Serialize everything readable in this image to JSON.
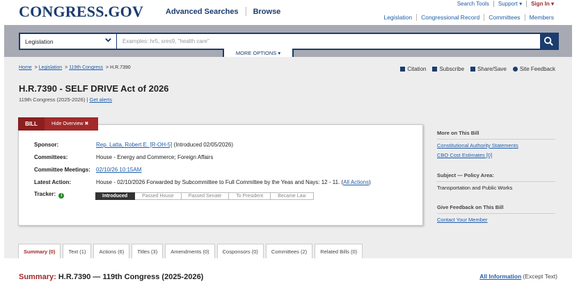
{
  "header": {
    "logo": "CONGRESS.GOV",
    "primary_nav": [
      "Advanced Searches",
      "Browse"
    ],
    "utility": {
      "search_tools": "Search Tools",
      "support": "Support ▾",
      "sign_in": "Sign In ▾"
    },
    "secondary_nav": [
      "Legislation",
      "Congressional Record",
      "Committees",
      "Members"
    ]
  },
  "search": {
    "scope": "Legislation",
    "placeholder": "Examples: hr5, sres9, \"health care\"",
    "more_options": "MORE OPTIONS ▾"
  },
  "breadcrumb": {
    "links": [
      "Home",
      "119th Congress"
    ],
    "legislation": "Legislation",
    "separator": ">",
    "current": "H.R.7390"
  },
  "share_tools": [
    "Citation",
    "Subscribe",
    "Share/Save",
    "Site Feedback"
  ],
  "bill": {
    "title": "H.R.7390 - SELF DRIVE Act of 2026",
    "congress": "119th Congress (2025-2026)",
    "congress_sep": "|",
    "get_alerts": "Get alerts"
  },
  "overview": {
    "tab_label": "BILL",
    "hide_label": "Hide Overview ✖",
    "sponsor_label": "Sponsor:",
    "sponsor_link": "Rep. Latta, Robert E. [R-OH-5]",
    "sponsor_intro": "(Introduced 02/05/2026)",
    "committees_label": "Committees:",
    "committees_value": "House - Energy and Commerce; Foreign Affairs",
    "meetings_label": "Committee Meetings:",
    "meetings_value": "02/10/26 10:15AM",
    "latest_label": "Latest Action:",
    "latest_value": "House - 02/10/2026 Forwarded by Subcommittee to Full Committee by the Yeas and Nays: 12 - 11.",
    "all_actions": "All Actions",
    "tracker_label": "Tracker:",
    "tracker_info": "i",
    "tracker_steps": [
      "Introduced",
      "Passed House",
      "Passed Senate",
      "To President",
      "Became Law"
    ],
    "tracker_current_step": "Introduced"
  },
  "sidebar": {
    "more_head": "More on This Bill",
    "more_links": [
      "Constitutional Authority Statements",
      "CBO Cost Estimates [0]"
    ],
    "policy_head": "Subject — Policy Area:",
    "policy_value": "Transportation and Public Works",
    "feedback_head": "Give Feedback on This Bill",
    "feedback_link": "Contact Your Member"
  },
  "tabs": [
    "Summary (0)",
    "Text (1)",
    "Actions (6)",
    "Titles (3)",
    "Amendments (0)",
    "Cosponsors (0)",
    "Committees (2)",
    "Related Bills (0)"
  ],
  "summary": {
    "label": "Summary:",
    "heading": "H.R.7390 — 119th Congress (2025-2026)",
    "all_info_link": "All Information",
    "all_info_suffix": "(Except Text)"
  },
  "colors": {
    "brand_navy": "#1b3c6e",
    "accent_red": "#a32a2a",
    "link_blue": "#1f5da8",
    "search_band": "#a7aab3",
    "page_gray": "#ededee"
  }
}
